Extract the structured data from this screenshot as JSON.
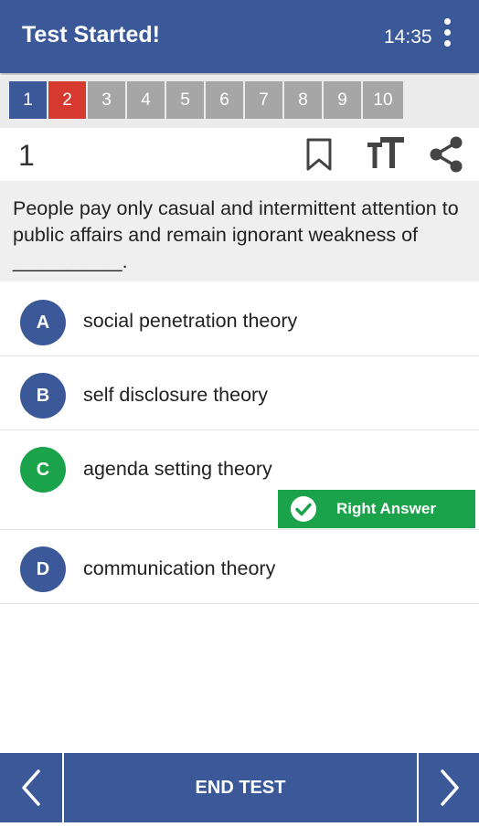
{
  "appbar": {
    "title": "Test Started!",
    "time": "14:35",
    "menu_icon": "more-vert-icon"
  },
  "question_nav": {
    "items": [
      {
        "label": "1",
        "state": "current"
      },
      {
        "label": "2",
        "state": "wrong"
      },
      {
        "label": "3",
        "state": "unanswered"
      },
      {
        "label": "4",
        "state": "unanswered"
      },
      {
        "label": "5",
        "state": "unanswered"
      },
      {
        "label": "6",
        "state": "unanswered"
      },
      {
        "label": "7",
        "state": "unanswered"
      },
      {
        "label": "8",
        "state": "unanswered"
      },
      {
        "label": "9",
        "state": "unanswered"
      },
      {
        "label": "10",
        "state": "unanswered"
      }
    ]
  },
  "question": {
    "number": "1",
    "text": "People pay only casual and intermittent attention to public affairs and remain ignorant weakness of __________.",
    "tools": [
      "bookmark-icon",
      "text-size-icon",
      "share-icon"
    ]
  },
  "options": [
    {
      "letter": "A",
      "text": "social penetration theory",
      "correct": false
    },
    {
      "letter": "B",
      "text": "self disclosure theory",
      "correct": false
    },
    {
      "letter": "C",
      "text": "agenda setting theory",
      "correct": true
    },
    {
      "letter": "D",
      "text": "communication theory",
      "correct": false
    }
  ],
  "feedback": {
    "right_answer_label": "Right Answer"
  },
  "footer": {
    "end_test_label": "END TEST",
    "prev_icon": "chevron-left-icon",
    "next_icon": "chevron-right-icon"
  },
  "colors": {
    "primary": "#3b5998",
    "wrong": "#d63a2f",
    "correct": "#1aa34a",
    "unanswered": "#a6a6a6"
  }
}
